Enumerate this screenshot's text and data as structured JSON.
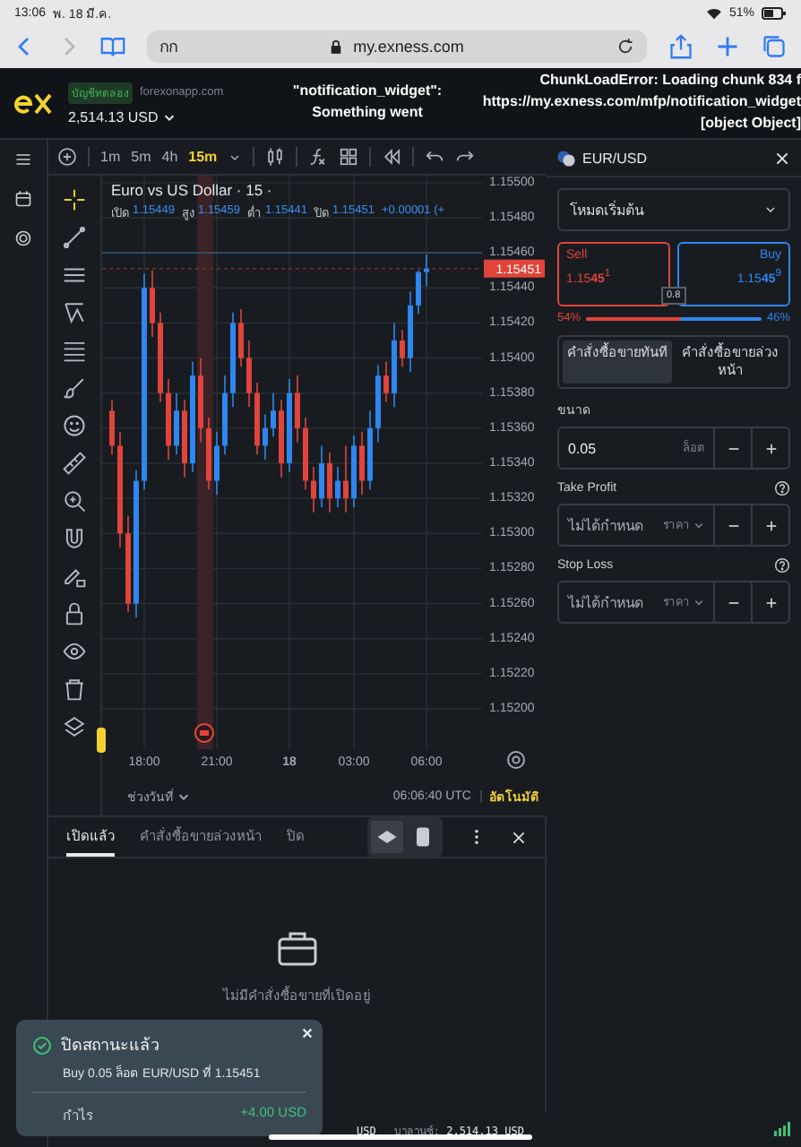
{
  "device_status": {
    "time": "13:06",
    "date": "พ. 18 มี.ค.",
    "battery": "51%"
  },
  "browser": {
    "text_size": "กก",
    "url": "my.exness.com"
  },
  "header": {
    "account_badge": "บัญชีทดลอง",
    "server": "forexonapp.com",
    "balance": "2,514.13 USD"
  },
  "errors": [
    {
      "lines": [
        "\"notification_widget\":",
        "Something went"
      ]
    },
    {
      "lines": [
        "ChunkLoadError: Loading chunk 834 f",
        "https://my.exness.com/mfp/notification_widget",
        "[object Object]"
      ]
    }
  ],
  "toolbar": {
    "timeframes": [
      {
        "label": "1m",
        "selected": false
      },
      {
        "label": "5m",
        "selected": false
      },
      {
        "label": "4h",
        "selected": false
      },
      {
        "label": "15m",
        "selected": true
      }
    ]
  },
  "chart": {
    "title": "Euro vs US Dollar · 15 ·",
    "ohlc": [
      {
        "label": "เปิด",
        "value": "1.15449"
      },
      {
        "label": "สูง",
        "value": "1.15459"
      },
      {
        "label": "ต่ำ",
        "value": "1.15441"
      },
      {
        "label": "ปิด",
        "value": "1.15451"
      }
    ],
    "change": "+0.00001 (+",
    "chart_data": {
      "type": "candlestick",
      "categories": [
        null,
        null,
        null,
        null,
        "18:00",
        null,
        null,
        null,
        null,
        null,
        null,
        null,
        null,
        "21:00",
        null,
        null,
        null,
        null,
        null,
        null,
        null,
        null,
        "18",
        null,
        null,
        null,
        null,
        null,
        null,
        null,
        "03:00",
        null,
        null,
        null,
        null,
        null,
        null,
        null,
        null,
        "06:00"
      ],
      "ohlc": [
        [
          1.1537,
          1.15376,
          1.15345,
          1.1535
        ],
        [
          1.1535,
          1.15358,
          1.15292,
          1.153
        ],
        [
          1.153,
          1.1531,
          1.15255,
          1.1526
        ],
        [
          1.1526,
          1.15336,
          1.15252,
          1.1533
        ],
        [
          1.1533,
          1.15448,
          1.15325,
          1.1544
        ],
        [
          1.1544,
          1.1545,
          1.15412,
          1.1542
        ],
        [
          1.1542,
          1.15426,
          1.15375,
          1.1538
        ],
        [
          1.1538,
          1.15388,
          1.15342,
          1.1535
        ],
        [
          1.1535,
          1.1538,
          1.15345,
          1.1537
        ],
        [
          1.1537,
          1.15376,
          1.15332,
          1.1534
        ],
        [
          1.1534,
          1.15398,
          1.15335,
          1.1539
        ],
        [
          1.1539,
          1.154,
          1.15352,
          1.1536
        ],
        [
          1.1536,
          1.15366,
          1.15325,
          1.1533
        ],
        [
          1.1533,
          1.15358,
          1.15322,
          1.1535
        ],
        [
          1.1535,
          1.1539,
          1.15345,
          1.1538
        ],
        [
          1.1538,
          1.15426,
          1.15372,
          1.1542
        ],
        [
          1.1542,
          1.15428,
          1.15395,
          1.154
        ],
        [
          1.154,
          1.1541,
          1.15372,
          1.1538
        ],
        [
          1.1538,
          1.15386,
          1.15345,
          1.1535
        ],
        [
          1.1535,
          1.15368,
          1.15342,
          1.1536
        ],
        [
          1.1536,
          1.1538,
          1.15355,
          1.1537
        ],
        [
          1.1537,
          1.15376,
          1.15332,
          1.1534
        ],
        [
          1.1534,
          1.15388,
          1.15335,
          1.1538
        ],
        [
          1.1538,
          1.1539,
          1.15352,
          1.1536
        ],
        [
          1.1536,
          1.15366,
          1.15325,
          1.1533
        ],
        [
          1.1533,
          1.15338,
          1.15312,
          1.1532
        ],
        [
          1.1532,
          1.1535,
          1.15315,
          1.1534
        ],
        [
          1.1534,
          1.15346,
          1.15312,
          1.1532
        ],
        [
          1.1532,
          1.15338,
          1.15315,
          1.1533
        ],
        [
          1.1533,
          1.1535,
          1.15312,
          1.1532
        ],
        [
          1.1532,
          1.15356,
          1.15315,
          1.1535
        ],
        [
          1.1535,
          1.15358,
          1.15322,
          1.1533
        ],
        [
          1.1533,
          1.1537,
          1.15325,
          1.1536
        ],
        [
          1.1536,
          1.15396,
          1.15352,
          1.1539
        ],
        [
          1.1539,
          1.15398,
          1.15375,
          1.1538
        ],
        [
          1.1538,
          1.1542,
          1.15372,
          1.1541
        ],
        [
          1.1541,
          1.15416,
          1.15395,
          1.154
        ],
        [
          1.154,
          1.15438,
          1.15392,
          1.1543
        ],
        [
          1.1543,
          1.1545,
          1.15425,
          1.15449
        ],
        [
          1.15449,
          1.15459,
          1.15441,
          1.15451
        ]
      ],
      "ylim": [
        1.15177,
        1.15504
      ],
      "yticks": [
        {
          "value": 1.155,
          "label": "1.15500"
        },
        {
          "value": 1.1548,
          "label": "1.15480"
        },
        {
          "value": 1.1546,
          "label": "1.15460"
        },
        {
          "value": 1.1544,
          "label": "1.15440"
        },
        {
          "value": 1.1542,
          "label": "1.15420"
        },
        {
          "value": 1.154,
          "label": "1.15400"
        },
        {
          "value": 1.1538,
          "label": "1.15380"
        },
        {
          "value": 1.1536,
          "label": "1.15360"
        },
        {
          "value": 1.1534,
          "label": "1.15340"
        },
        {
          "value": 1.1532,
          "label": "1.15320"
        },
        {
          "value": 1.153,
          "label": "1.15300"
        },
        {
          "value": 1.1528,
          "label": "1.15280"
        },
        {
          "value": 1.1526,
          "label": "1.15260"
        },
        {
          "value": 1.1524,
          "label": "1.15240"
        },
        {
          "value": 1.1522,
          "label": "1.15220"
        },
        {
          "value": 1.152,
          "label": "1.15200"
        }
      ],
      "grid": true,
      "ref_lines": [
        {
          "axis": "y",
          "value": 1.1546,
          "color": "#33506e"
        },
        {
          "axis": "y",
          "value": 1.15451,
          "color": "#7a2c2c"
        }
      ]
    },
    "price_tag": "1.15451",
    "range_label": "ช่วงวันที่",
    "clock": "06:06:40 UTC",
    "scale_mode": "อัตโนมัติ"
  },
  "positions": {
    "tabs": [
      {
        "label": "เปิดแล้ว",
        "selected": true
      },
      {
        "label": "คำสั่งซื้อขายล่วงหน้า",
        "selected": false
      },
      {
        "label": "ปิด",
        "selected": false
      }
    ],
    "view_modes": [
      {
        "selected": true
      },
      {
        "selected": false
      }
    ],
    "empty_text": "ไม่มีคำสั่งซื้อขายที่เปิดอยู่"
  },
  "order_panel": {
    "symbol": "EUR/USD",
    "mode": "โหมดเริ่มต้น",
    "sell": {
      "label": "Sell",
      "price": "1.15**45**$^{1}$"
    },
    "buy": {
      "label": "Buy",
      "price": "1.15**45**$^{9}$"
    },
    "spread": "0.8",
    "sentiment": {
      "sell_pct": "54%",
      "buy_pct": "46%",
      "level": 0.54
    },
    "order_types": [
      {
        "label": "คำสั่งซื้อขายทันที",
        "selected": true
      },
      {
        "label": "คำสั่งซื้อขายล่วงหน้า",
        "selected": false
      }
    ],
    "volume": {
      "label": "ขนาด",
      "value": "0.05",
      "unit": "ล็อต"
    },
    "take_profit": {
      "label": "Take Profit",
      "placeholder": "ไม่ได้กำหนด",
      "unit": "ราคา"
    },
    "stop_loss": {
      "label": "Stop Loss",
      "placeholder": "ไม่ได้กำหนด",
      "unit": "ราคา"
    }
  },
  "footer": {
    "cut_text": "USD",
    "balance_label": "บาลานซ์:",
    "balance": "2,514.13 USD"
  },
  "toast": {
    "title": "ปิดสถานะแล้ว",
    "detail": "Buy 0.05 ล็อต EUR/USD ที่ 1.15451",
    "profit_label": "กำไร",
    "profit": "+4.00 USD"
  }
}
